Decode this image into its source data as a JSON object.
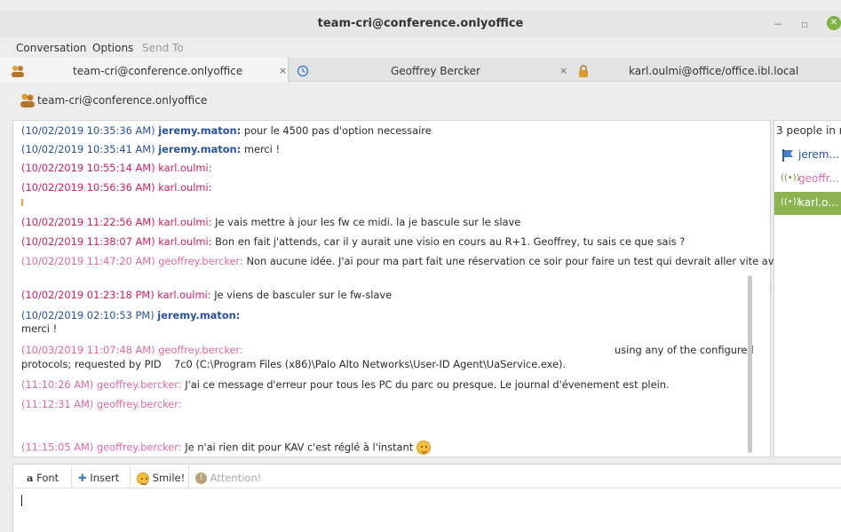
{
  "window": {
    "title": "team-cri@conference.onlyoffice",
    "minimize": "−",
    "restore": "▫",
    "close": "✕"
  },
  "menu": {
    "conversation": "Conversation",
    "options": "Options",
    "send_to": "Send To"
  },
  "tabs": [
    {
      "label": "team-cri@conference.onlyoffice",
      "close": "×"
    },
    {
      "label": "Geoffrey Bercker",
      "close": "×"
    },
    {
      "label": "karl.oulmi@office/office.ibl.local"
    }
  ],
  "room": {
    "title": "team-cri@conference.onlyoffice"
  },
  "messages": [
    {
      "ts": "(10/02/2019 10:35:36 AM)",
      "nick": "jeremy.maton:",
      "text": "pour le 4500 pas d'option necessaire"
    },
    {
      "ts": "(10/02/2019 10:35:41 AM)",
      "nick": "jeremy.maton:",
      "text": "merci !"
    },
    {
      "ts": "(10/02/2019 10:55:14 AM)",
      "nick": "karl.oulmi:",
      "text": ""
    },
    {
      "ts": "(10/02/2019 10:56:36 AM)",
      "nick": "karl.oulmi:",
      "text": ""
    },
    {
      "ts": "(10/02/2019 11:22:56 AM)",
      "nick": "karl.oulmi:",
      "text": "Je vais mettre à jour les fw ce midi. la je bascule sur le slave"
    },
    {
      "ts": "(10/02/2019 11:38:07 AM)",
      "nick": "karl.oulmi:",
      "text": "Bon en fait j'attends, car il y aurait une visio en cours au R+1. Geoffrey, tu sais ce que sais ?"
    },
    {
      "ts": "(10/02/2019 11:47:20 AM)",
      "nick": "geoffrey.bercker:",
      "text": "Non aucune idée. J'ai pour ma part fait une réservation ce soir pour faire un test qui devrait aller vite avec"
    },
    {
      "ts": "(10/02/2019 01:23:18 PM)",
      "nick": "karl.oulmi:",
      "text": "Je viens de basculer sur le fw-slave"
    },
    {
      "ts": "(10/02/2019 02:10:53 PM)",
      "nick": "jeremy.maton:",
      "text": "",
      "line2": "merci !"
    },
    {
      "ts": "(10/03/2019 11:07:48 AM)",
      "nick": "geoffrey.bercker:",
      "text": "",
      "text_right": "using any of the configured",
      "line2_a": "protocols; requested by PID",
      "line2_b": "7c0 (C:\\Program Files (x86)\\Palo Alto Networks\\User-ID Agent\\UaService.exe)."
    },
    {
      "ts": "(11:10:26 AM)",
      "nick": "geoffrey.bercker:",
      "text": "J'ai ce message d'erreur pour tous les PC du parc ou presque. Le journal d'évenement est plein."
    },
    {
      "ts": "(11:12:31 AM)",
      "nick": "geoffrey.bercker:",
      "text": ""
    },
    {
      "ts": "(11:15:05 AM)",
      "nick": "geoffrey.bercker:",
      "text": "Je n'ai rien dit pour KAV c'est réglé à l'instant"
    }
  ],
  "participants": {
    "count_label": "3 people in r...",
    "list": [
      {
        "name": "jerem...",
        "color": "#2952a3",
        "icon": "flag-icon"
      },
      {
        "name": "geoffr...",
        "color": "#e06aa0",
        "icon": "broadcast-icon"
      },
      {
        "name": "karl.o...",
        "color": "#ffffff",
        "icon": "broadcast-icon"
      }
    ]
  },
  "compose": {
    "font": "Font",
    "insert": "Insert",
    "smile": "Smile!",
    "attention": "Attention!"
  },
  "colors": {
    "jeremy": "#2952a3",
    "karl": "#d11f5b",
    "geoffrey": "#e06aa0",
    "selected": "#8bb34f"
  }
}
